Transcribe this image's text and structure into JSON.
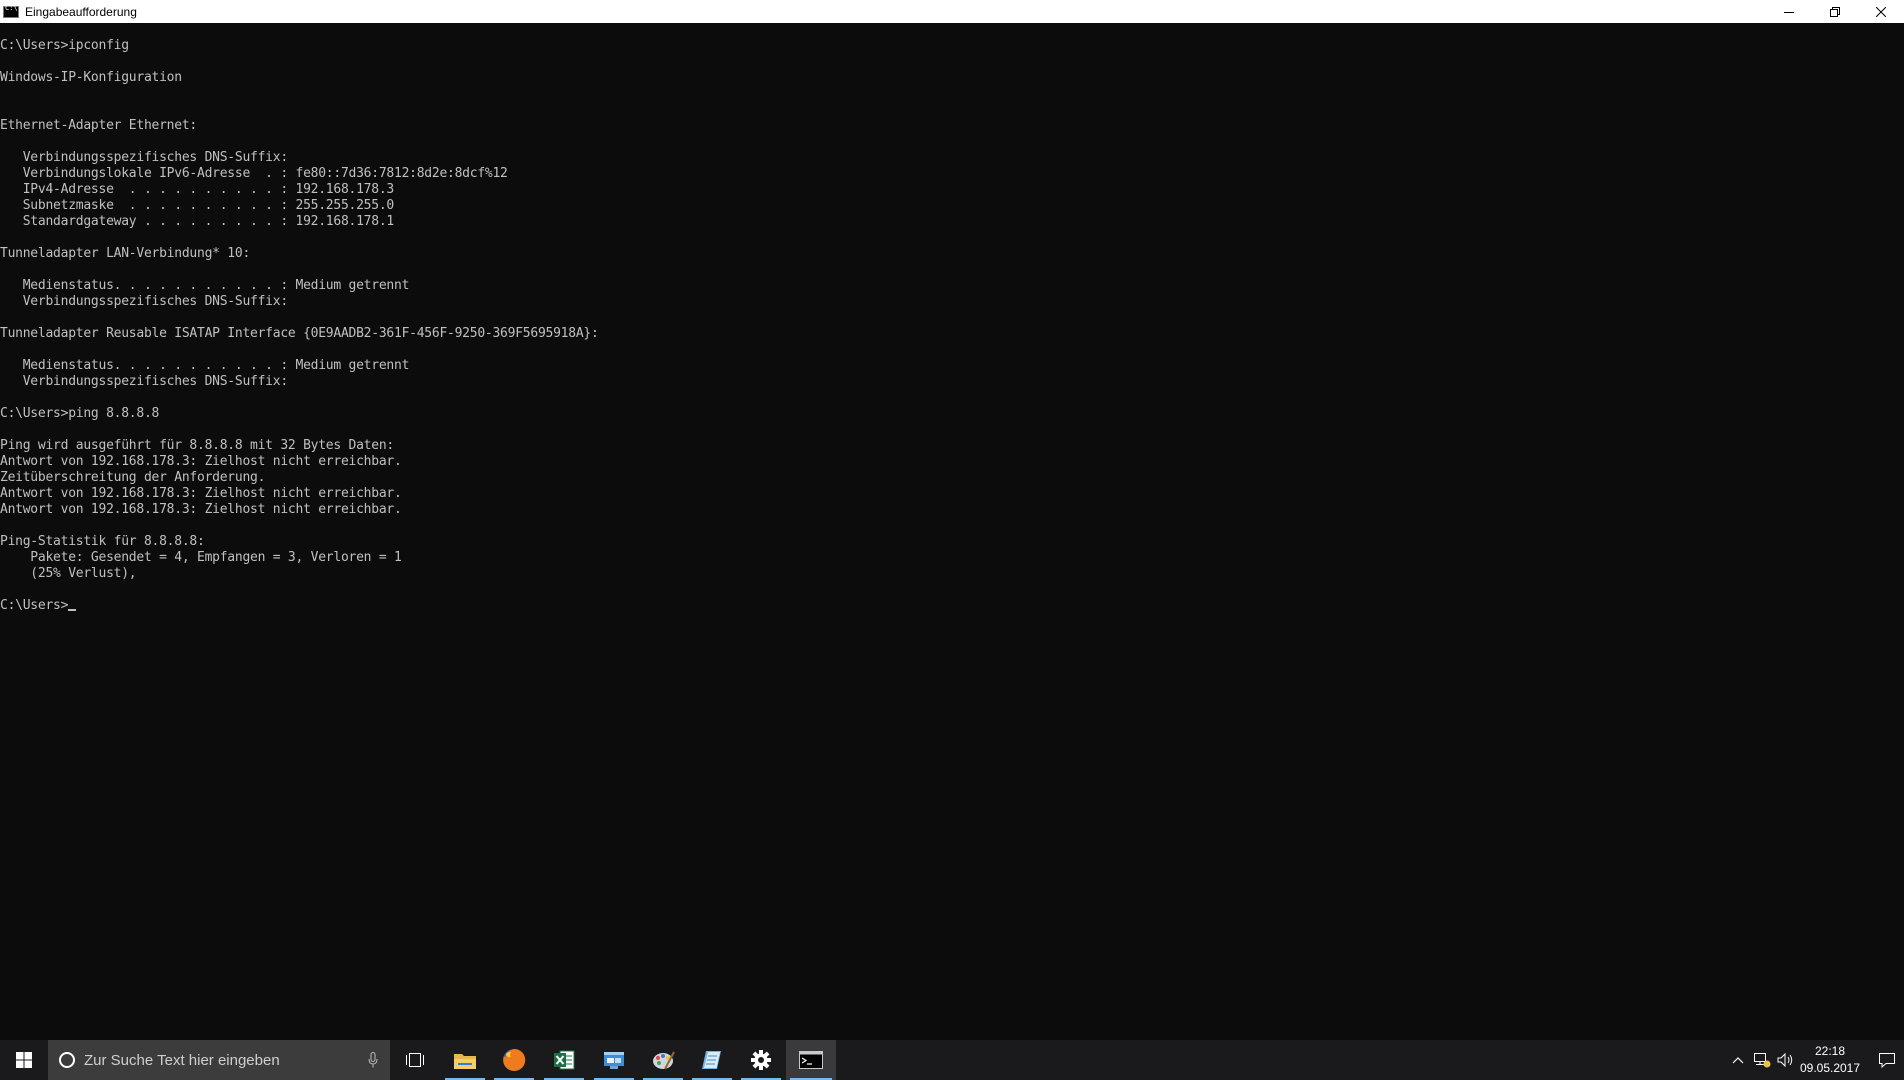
{
  "window": {
    "title": "Eingabeaufforderung"
  },
  "console": {
    "lines": [
      "C:\\Users>ipconfig",
      "",
      "Windows-IP-Konfiguration",
      "",
      "",
      "Ethernet-Adapter Ethernet:",
      "",
      "   Verbindungsspezifisches DNS-Suffix:",
      "   Verbindungslokale IPv6-Adresse  . : fe80::7d36:7812:8d2e:8dcf%12",
      "   IPv4-Adresse  . . . . . . . . . . : 192.168.178.3",
      "   Subnetzmaske  . . . . . . . . . . : 255.255.255.0",
      "   Standardgateway . . . . . . . . . : 192.168.178.1",
      "",
      "Tunneladapter LAN-Verbindung* 10:",
      "",
      "   Medienstatus. . . . . . . . . . . : Medium getrennt",
      "   Verbindungsspezifisches DNS-Suffix:",
      "",
      "Tunneladapter Reusable ISATAP Interface {0E9AADB2-361F-456F-9250-369F5695918A}:",
      "",
      "   Medienstatus. . . . . . . . . . . : Medium getrennt",
      "   Verbindungsspezifisches DNS-Suffix:",
      "",
      "C:\\Users>ping 8.8.8.8",
      "",
      "Ping wird ausgeführt für 8.8.8.8 mit 32 Bytes Daten:",
      "Antwort von 192.168.178.3: Zielhost nicht erreichbar.",
      "Zeitüberschreitung der Anforderung.",
      "Antwort von 192.168.178.3: Zielhost nicht erreichbar.",
      "Antwort von 192.168.178.3: Zielhost nicht erreichbar.",
      "",
      "Ping-Statistik für 8.8.8.8:",
      "    Pakete: Gesendet = 4, Empfangen = 3, Verloren = 1",
      "    (25% Verlust),",
      "",
      "C:\\Users>"
    ]
  },
  "taskbar": {
    "search_placeholder": "Zur Suche Text hier eingeben",
    "apps": [
      {
        "name": "file-explorer",
        "icon": "folder-icon",
        "running": true
      },
      {
        "name": "firefox",
        "icon": "firefox-icon",
        "running": true
      },
      {
        "name": "excel",
        "icon": "excel-icon",
        "running": true
      },
      {
        "name": "network",
        "icon": "network-window-icon",
        "running": true
      },
      {
        "name": "paint",
        "icon": "paint-icon",
        "running": true
      },
      {
        "name": "notepad",
        "icon": "notepad-icon",
        "running": true
      },
      {
        "name": "settings",
        "icon": "gear-icon",
        "running": true
      },
      {
        "name": "command-prompt",
        "icon": "terminal-icon",
        "running": true,
        "active": true
      }
    ],
    "clock": {
      "time": "22:18",
      "date": "09.05.2017"
    }
  },
  "colors": {
    "console_bg": "#0c0c0c",
    "console_fg": "#c0c0c0",
    "taskbar_bg": "#1a1a1d",
    "accent": "#76b9ed"
  }
}
